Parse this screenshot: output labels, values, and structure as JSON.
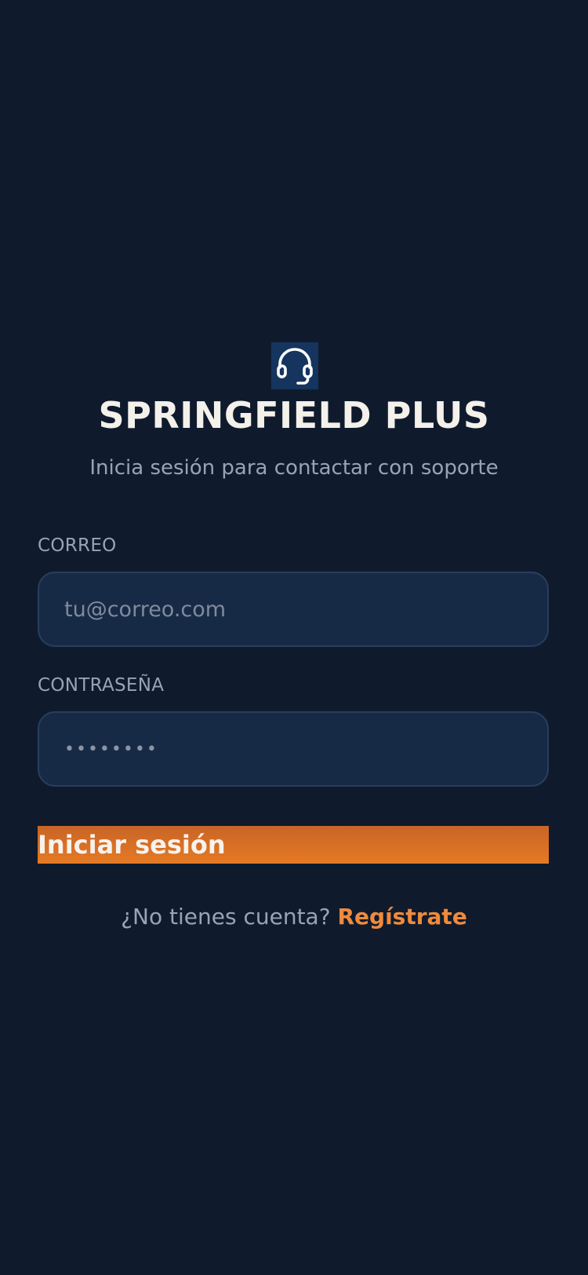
{
  "app": {
    "title": "SPRINGFIELD PLUS",
    "subtitle": "Inicia sesión para contactar con soporte",
    "logo_icon": "headset-icon"
  },
  "form": {
    "email": {
      "label": "CORREO",
      "placeholder": "tu@correo.com",
      "value": ""
    },
    "password": {
      "label": "CONTRASEÑA",
      "masked_value": "••••••••"
    },
    "submit_label": "Iniciar sesión"
  },
  "signup": {
    "prompt": "¿No tienes cuenta?",
    "link_label": "Regístrate"
  },
  "colors": {
    "background": "#0f1b2d",
    "input_background": "#172a45",
    "accent": "#e57a24",
    "link": "#f08a3c"
  }
}
